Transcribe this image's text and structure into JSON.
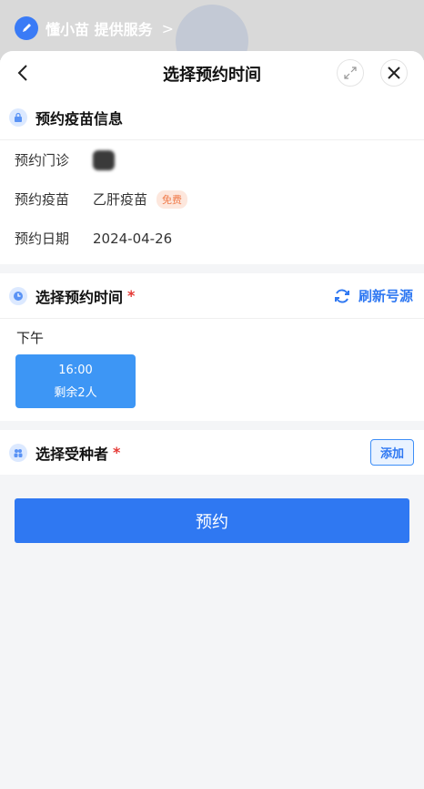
{
  "provider": {
    "name": "懂小苗 提供服务",
    "chevron": ">"
  },
  "header": {
    "title": "选择预约时间"
  },
  "vaccine_info": {
    "title": "预约疫苗信息",
    "rows": [
      {
        "label": "预约门诊",
        "value": ""
      },
      {
        "label": "预约疫苗",
        "value": "乙肝疫苗",
        "badge": "免费"
      },
      {
        "label": "预约日期",
        "value": "2024-04-26"
      }
    ]
  },
  "time_select": {
    "title": "选择预约时间",
    "required": "*",
    "refresh_label": "刷新号源",
    "period": "下午",
    "slot": {
      "time": "16:00",
      "remaining": "剩余2人"
    }
  },
  "recipient": {
    "title": "选择受种者",
    "required": "*",
    "add_label": "添加"
  },
  "submit_label": "预约",
  "colors": {
    "accent": "#2f78f2",
    "slot": "#3d96f5",
    "required": "#e53935",
    "badge_bg": "#fde7dd",
    "badge_text": "#f07b4a"
  }
}
